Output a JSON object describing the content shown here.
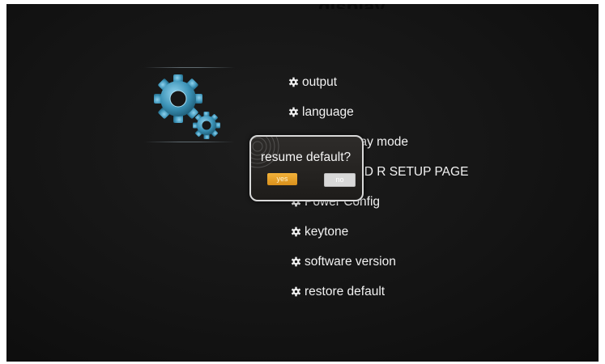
{
  "header": {
    "clipped_title": "display"
  },
  "menu": {
    "items": [
      {
        "label": "output"
      },
      {
        "label": "language"
      },
      {
        "label": "Custom Play mode"
      },
      {
        "label": "ADVANCED R SETUP PAGE"
      },
      {
        "label": "Power Config"
      },
      {
        "label": "keytone"
      },
      {
        "label": "software version"
      },
      {
        "label": "restore default"
      }
    ]
  },
  "dialog": {
    "title": "resume default?",
    "yes_label": "yes",
    "no_label": "no"
  },
  "colors": {
    "screen_bg": "#141414",
    "gear": "#3b92b6",
    "yes_button": "#e8a52c",
    "no_button": "#d8d8d8",
    "dialog_border": "#d9d9d9"
  }
}
